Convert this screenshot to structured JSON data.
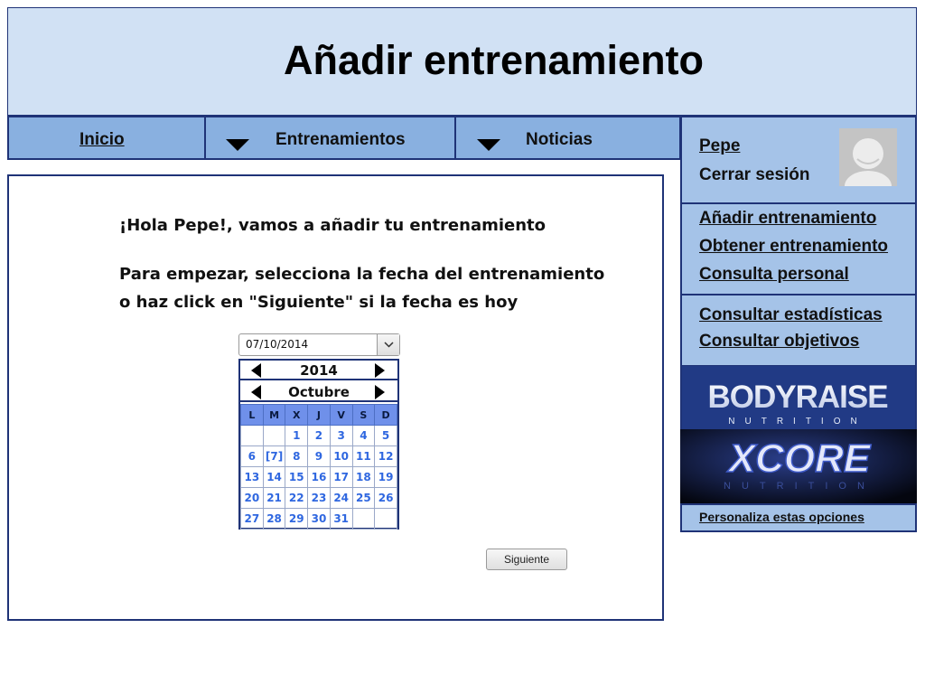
{
  "header": {
    "title": "Añadir entrenamiento"
  },
  "nav": {
    "inicio": "Inicio",
    "entrenamientos": "Entrenamientos",
    "noticias": "Noticias"
  },
  "main": {
    "greeting": "¡Hola Pepe!, vamos a añadir tu entrenamiento",
    "instruction_line1": "Para empezar, selecciona la fecha del entrenamiento",
    "instruction_line2": "o haz click en \"Siguiente\" si la fecha es hoy",
    "date_value": "07/10/2014",
    "next_label": "Siguiente"
  },
  "calendar": {
    "year": "2014",
    "month": "Octubre",
    "weekdays": [
      "L",
      "M",
      "X",
      "J",
      "V",
      "S",
      "D"
    ],
    "weeks": [
      [
        "",
        "",
        "1",
        "2",
        "3",
        "4",
        "5"
      ],
      [
        "6",
        "[7]",
        "8",
        "9",
        "10",
        "11",
        "12"
      ],
      [
        "13",
        "14",
        "15",
        "16",
        "17",
        "18",
        "19"
      ],
      [
        "20",
        "21",
        "22",
        "23",
        "24",
        "25",
        "26"
      ],
      [
        "27",
        "28",
        "29",
        "30",
        "31",
        "",
        ""
      ]
    ]
  },
  "user": {
    "name": "Pepe",
    "logout": "Cerrar sesión"
  },
  "sidebar": {
    "group1": [
      "Añadir entrenamiento",
      "Obtener entrenamiento",
      "Consulta personal"
    ],
    "group2": [
      "Consultar estadísticas",
      "Consultar objetivos"
    ],
    "customize": "Personaliza estas opciones"
  },
  "ads": {
    "bodyraise_name": "BODYRAISE",
    "bodyraise_sub": "NUTRITION",
    "xcore_name": "XCORE",
    "xcore_sub": "NUTRITION"
  },
  "colors": {
    "header_bg": "#d1e1f4",
    "nav_bg": "#89b0e0",
    "sidebar_bg": "#a5c3e8",
    "border": "#1f3377",
    "calendar_day": "#2f67e0",
    "calendar_header": "#6f90ea"
  }
}
